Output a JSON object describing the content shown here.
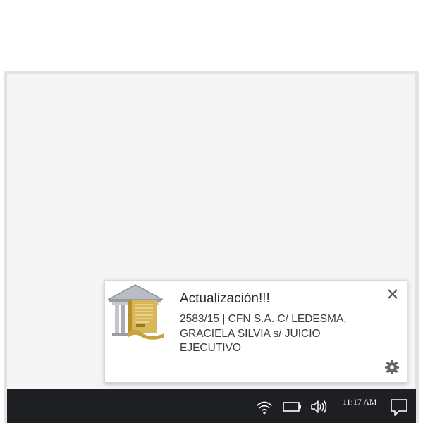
{
  "notification": {
    "title": "Actualización!!!",
    "body": "2583/15 | CFN S.A. C/ LEDESMA, GRACIELA SILVIA s/ JUICIO EJECUTIVO",
    "app_icon": "courthouse-scroll-icon",
    "close_icon": "close-icon",
    "settings_icon": "gear-icon"
  },
  "taskbar": {
    "time": "11:17 AM",
    "tray_icons": [
      "wifi-icon",
      "battery-icon",
      "volume-icon",
      "action-center-icon"
    ]
  },
  "colors": {
    "taskbar_background": "#1e1f22",
    "desktop_background": "#f5f5f5",
    "toast_background": "#ffffff"
  }
}
